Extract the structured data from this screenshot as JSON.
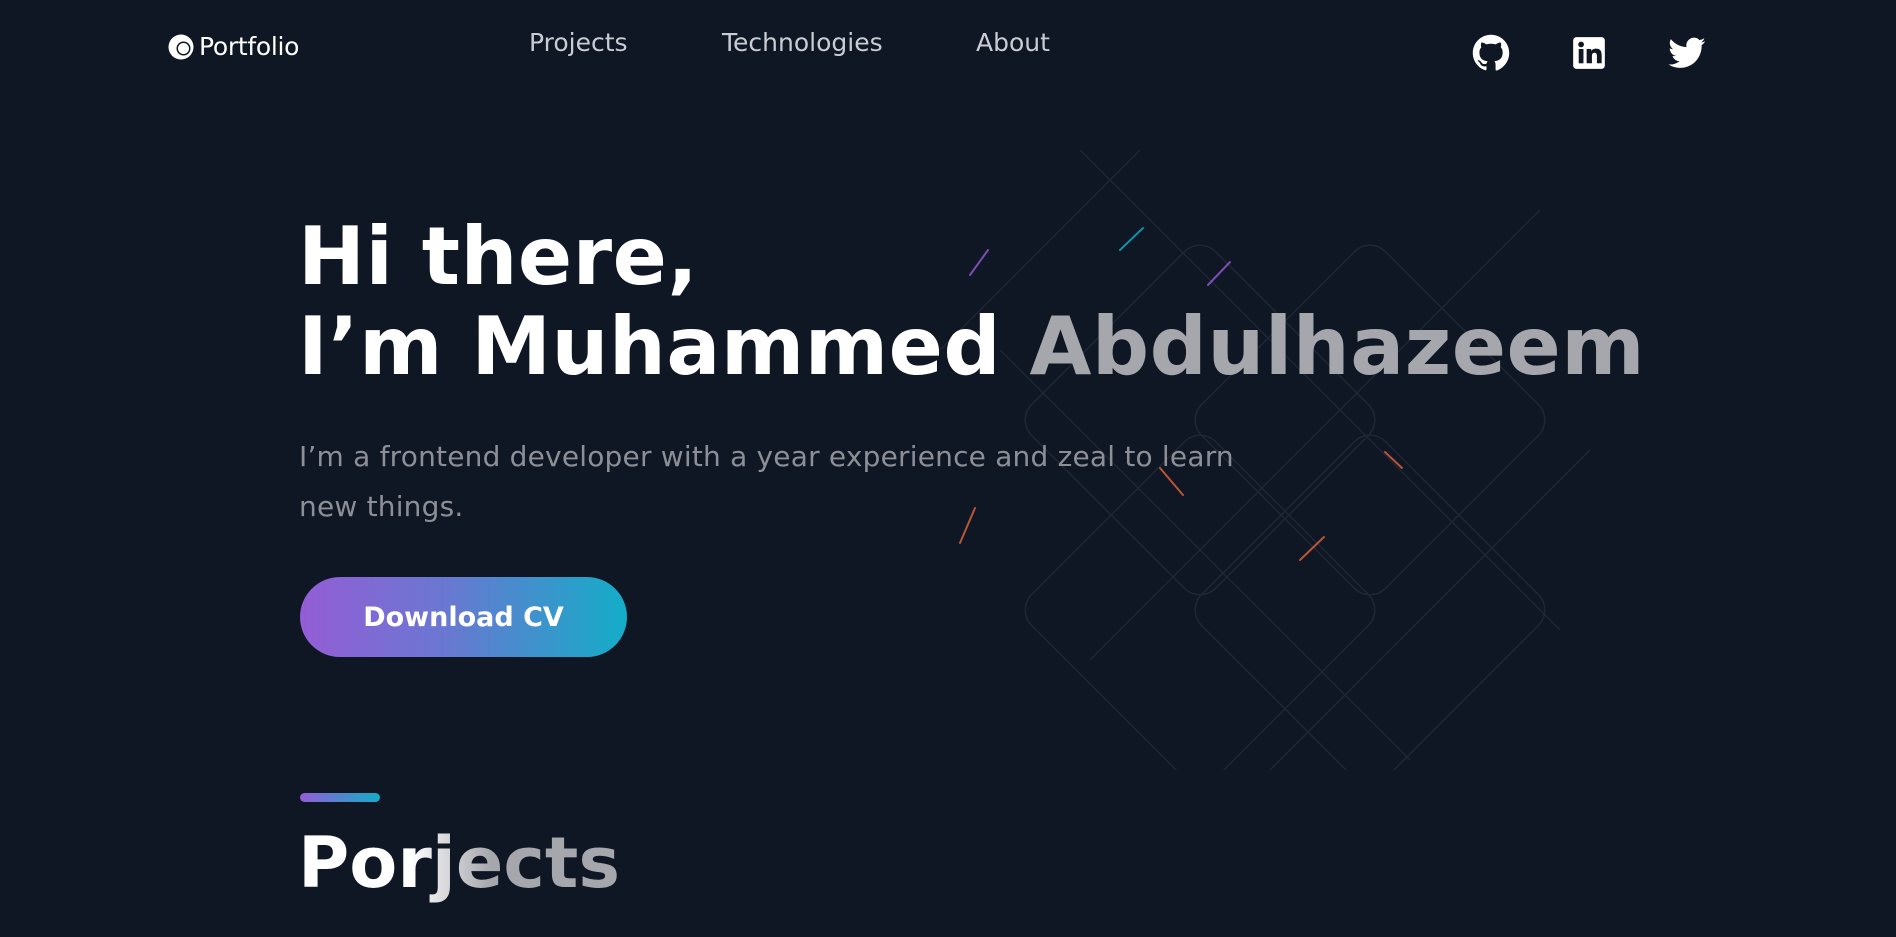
{
  "header": {
    "logo_text": "Portfolio",
    "nav": [
      {
        "label": "Projects"
      },
      {
        "label": "Technologies"
      },
      {
        "label": "About"
      }
    ],
    "social": [
      {
        "icon": "github-icon"
      },
      {
        "icon": "linkedin-icon"
      },
      {
        "icon": "twitter-icon"
      }
    ]
  },
  "hero": {
    "line1": "Hi there,",
    "line2_white": "I’m Muhammed ",
    "line2_grey": "Abdulhazeem",
    "description": "I’m a frontend developer with a year experience and zeal to learn new things.",
    "cta_label": "Download CV"
  },
  "section": {
    "title": "Porjects"
  },
  "colors": {
    "background": "#0f1624",
    "gradient_start": "#945dd6",
    "gradient_end": "#13adc7",
    "muted_text": "#8d8f97"
  }
}
